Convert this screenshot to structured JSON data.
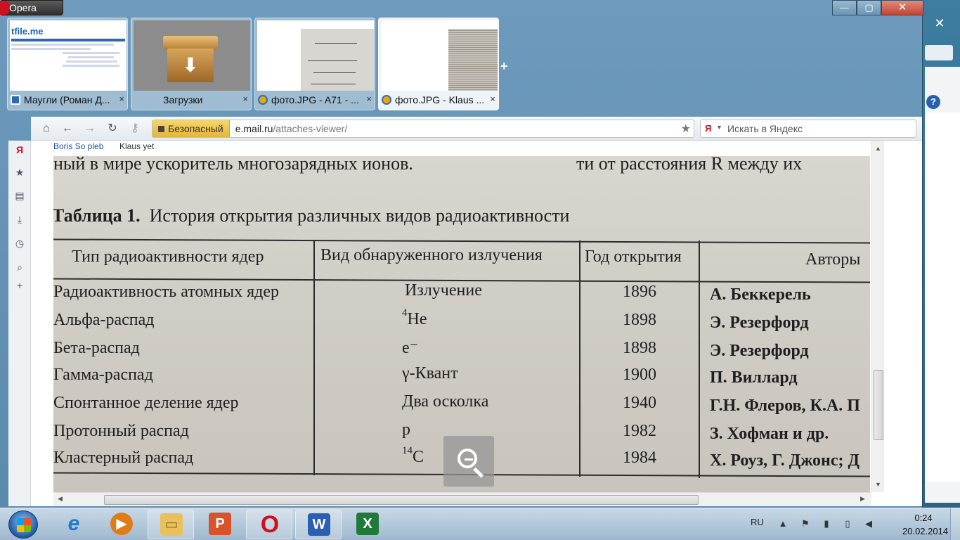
{
  "window": {
    "app_title": "Opera",
    "controls": {
      "minimize": "—",
      "maximize": "▢",
      "close": "✕"
    }
  },
  "background_window": {
    "close": "✕",
    "help": "?"
  },
  "tabs": [
    {
      "label": "Маугли (Роман Д...",
      "close": "×",
      "thumb": "tfile.me"
    },
    {
      "label": "Загрузки",
      "close": "×"
    },
    {
      "label": "фото.JPG - A71 - ...",
      "close": "×"
    },
    {
      "label": "фото.JPG - Klaus ...",
      "close": "×",
      "active": true
    }
  ],
  "new_tab": "+",
  "toolbar": {
    "security_label": "Безопасный",
    "url_host": "e.mail.ru",
    "url_path": "/attaches-viewer/",
    "search_engine": "Я",
    "search_placeholder": "Искать в Яндекс"
  },
  "viewer": {
    "sender": "Boris So pleb",
    "recipient": "Klaus yet",
    "close": "×"
  },
  "photo": {
    "top_text_left": "ный в мире ускоритель многозарядных ионов.",
    "top_text_right": "ти  от  расстояния  R  между  их",
    "caption_bold": "Таблица 1.",
    "caption_text": "История открытия различных видов радиоактивности",
    "headers": [
      "Тип радиоактивности ядер",
      "Вид обнаруженного излучения",
      "Год открытия",
      "Авторы"
    ],
    "rows": [
      {
        "type": "Радиоактивность атомных ядер",
        "radiation_sup": "",
        "radiation": "Излучение",
        "year": "1896",
        "authors": "А. Беккерель"
      },
      {
        "type": "Альфа-распад",
        "radiation_sup": "4",
        "radiation": "He",
        "year": "1898",
        "authors": "Э. Резерфорд"
      },
      {
        "type": "Бета-распад",
        "radiation_sup": "",
        "radiation": "e⁻",
        "year": "1898",
        "authors": "Э. Резерфорд"
      },
      {
        "type": "Гамма-распад",
        "radiation_sup": "",
        "radiation": "γ-Квант",
        "year": "1900",
        "authors": "П. Виллард"
      },
      {
        "type": "Спонтанное деление ядер",
        "radiation_sup": "",
        "radiation": "Два осколка",
        "year": "1940",
        "authors": "Г.Н. Флеров, К.А. П"
      },
      {
        "type": "Протонный распад",
        "radiation_sup": "",
        "radiation": "p",
        "year": "1982",
        "authors": "З. Хофман и др."
      },
      {
        "type": "Кластерный распад",
        "radiation_sup": "14",
        "radiation": "C",
        "year": "1984",
        "authors": "Х. Роуз, Г. Джонс; Д"
      }
    ]
  },
  "taskbar": {
    "language": "RU",
    "time": "0:24",
    "date": "20.02.2014"
  },
  "icons": {
    "home": "⌂",
    "back": "←",
    "forward": "→",
    "reload": "↻",
    "key": "⚷",
    "star": "★",
    "search": "⌕",
    "plus": "+",
    "up": "▲",
    "down": "▼",
    "left": "◀",
    "right": "▶"
  }
}
